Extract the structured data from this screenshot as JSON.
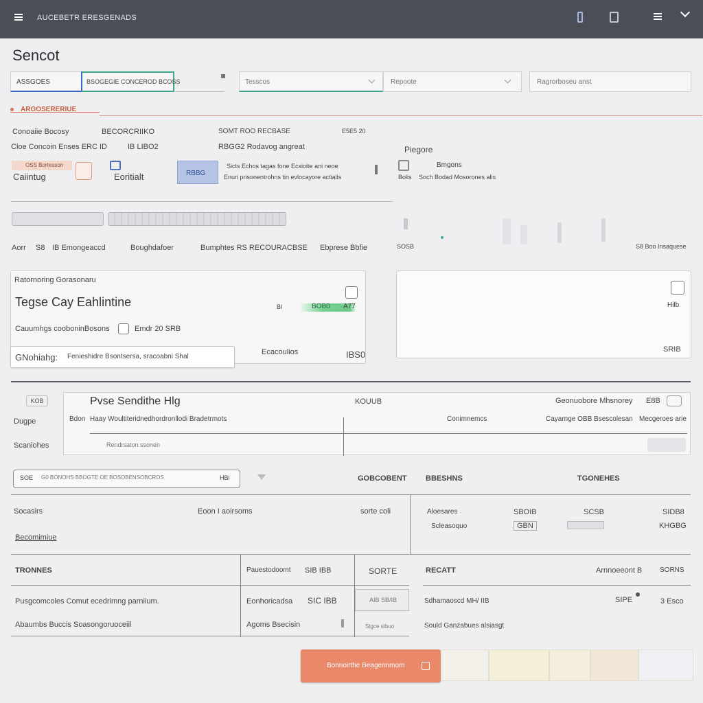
{
  "header": {
    "title": "AUCEBETR ERESGENADS",
    "icons": [
      "menu-icon",
      "phone-icon",
      "document-icon",
      "list-icon",
      "chevron-down-icon"
    ]
  },
  "page": {
    "title": "Sencot"
  },
  "filters": {
    "field1_label": "ASSGOES",
    "field1_value": "BSOGEGIE CONCEROD BCOSS",
    "field2": "Tesscos",
    "field3": "Repoote",
    "field4": "Ragrorboseu anst"
  },
  "section_heading": "ARGOSERERIUE",
  "info": {
    "row1": [
      "Conoaiie Bocosy",
      "BECORCRIIKO",
      "SOMT ROO RECBASE",
      "E5E5 20"
    ],
    "row2": [
      "Cloe Concoin Enses ERC ID",
      "IB LIBO2",
      "RBGG2 Rodavog angreat"
    ],
    "tile1": {
      "top": "OSS Bortesson",
      "bottom": "Caiintug"
    },
    "tile2": {
      "label": "Eoritialt"
    },
    "tile3": {
      "badge": "RBBG",
      "line1": "Sicts Echos tagas fone Ecxioite ani neoe",
      "line2": "Enuri prisonentrohns tin evlocayore actialis"
    },
    "side_title": "Piegore",
    "side_label1": "Bmgons",
    "side_row": [
      "Bolis",
      "Soch Bodad Mosorones alis"
    ]
  },
  "bars": {
    "bar1": "",
    "bar2": ""
  },
  "meta_row": [
    "Aorr",
    "S8",
    "IB Emongeaccd",
    "Boughdafoer",
    "Bumphtes RS RECOURACBSE",
    "Ebprese Bbfie"
  ],
  "side_chart": {
    "left": "SOSB",
    "right": "S8 Boo Insaquese"
  },
  "card_left": {
    "kicker": "Ratornoring Gorasonaru",
    "title": "Tegse  Cay Eahlintine",
    "badge_label": "BI",
    "badge_value": "BOB0",
    "badge_suffix": "A77",
    "row_label": "Cauumhgs cooboninBosons",
    "row_value": "Emdr 20 SRB",
    "input_prefix": "GNohiahg:",
    "input_text": "Fenieshidre Bsontsersa, sracoabni Shal",
    "foot_label": "Ecacoulios",
    "foot_value": "IBS0"
  },
  "card_right": {
    "value1": "Hilb",
    "value2": "SRIB"
  },
  "panel": {
    "tag": "KOB",
    "title": "Pvse Sendithe Hlg",
    "tag2": "KOUUB",
    "right_label": "Geonuobore Mhsnorey",
    "right_value": "E8B",
    "left_labels": [
      "Dugpe",
      "Scaniohes"
    ],
    "row_label": "Bdon",
    "row_text": "Haay Woultiteridnedhordronllodi Bradetrmots",
    "col2": "Conimnemcs",
    "col3": "Cayarnge OBB Bsescolesan",
    "col4": "Mecgeroes arie",
    "sub_text": "Rendrsaton ssonen"
  },
  "search": {
    "prefix": "SOE",
    "placeholder": "G0 BONOHS BBOGTE OE BOSOBENSOBCROS",
    "suffix": "HBi"
  },
  "table_headers": [
    "GOBCOBENT",
    "BBESHNS",
    "TGONEHES"
  ],
  "table_block": {
    "left_labels": [
      "Socasirs",
      "Becomimiue"
    ],
    "mid": "Eoon I aoirsoms",
    "mid2": "sorte coli",
    "rows": [
      [
        "Aloesares",
        "SBOIB",
        "SCSB",
        "SIDB8"
      ],
      [
        "Scleasoquo",
        "GBN",
        "",
        "KHGBG"
      ]
    ]
  },
  "lower_table": {
    "headers": [
      "TRONNES",
      "Pauestodoomt",
      "SIB IBB",
      "SORTE",
      "RECATT",
      "Arnnoeeont B",
      "SORNS"
    ],
    "left_rows": [
      "Pusgcomcoles Comut ecedrimng parniium.",
      "Abaumbs Buccis Soasongoruoceiil"
    ],
    "mid_rows": [
      [
        "Eonhoricadsa",
        "SIC IBB"
      ],
      [
        "Agoms Bsecisin",
        ""
      ]
    ],
    "mid_small": [
      "AIB SB/IB",
      "Stgce stbuo"
    ],
    "right_rows": [
      [
        "Sdhamaoscd MH/ IIB",
        "SIPE",
        "3 Esco"
      ],
      [
        "Sould Ganzabues alsiasgt",
        "",
        ""
      ]
    ]
  },
  "action": {
    "primary_label": "Bonnoirthe Beagennmom"
  },
  "colors": {
    "header": "#4a4f57",
    "accent": "#e9896a",
    "green": "#6fc989",
    "teal": "#3da88c",
    "blue": "#3a6bc8"
  }
}
